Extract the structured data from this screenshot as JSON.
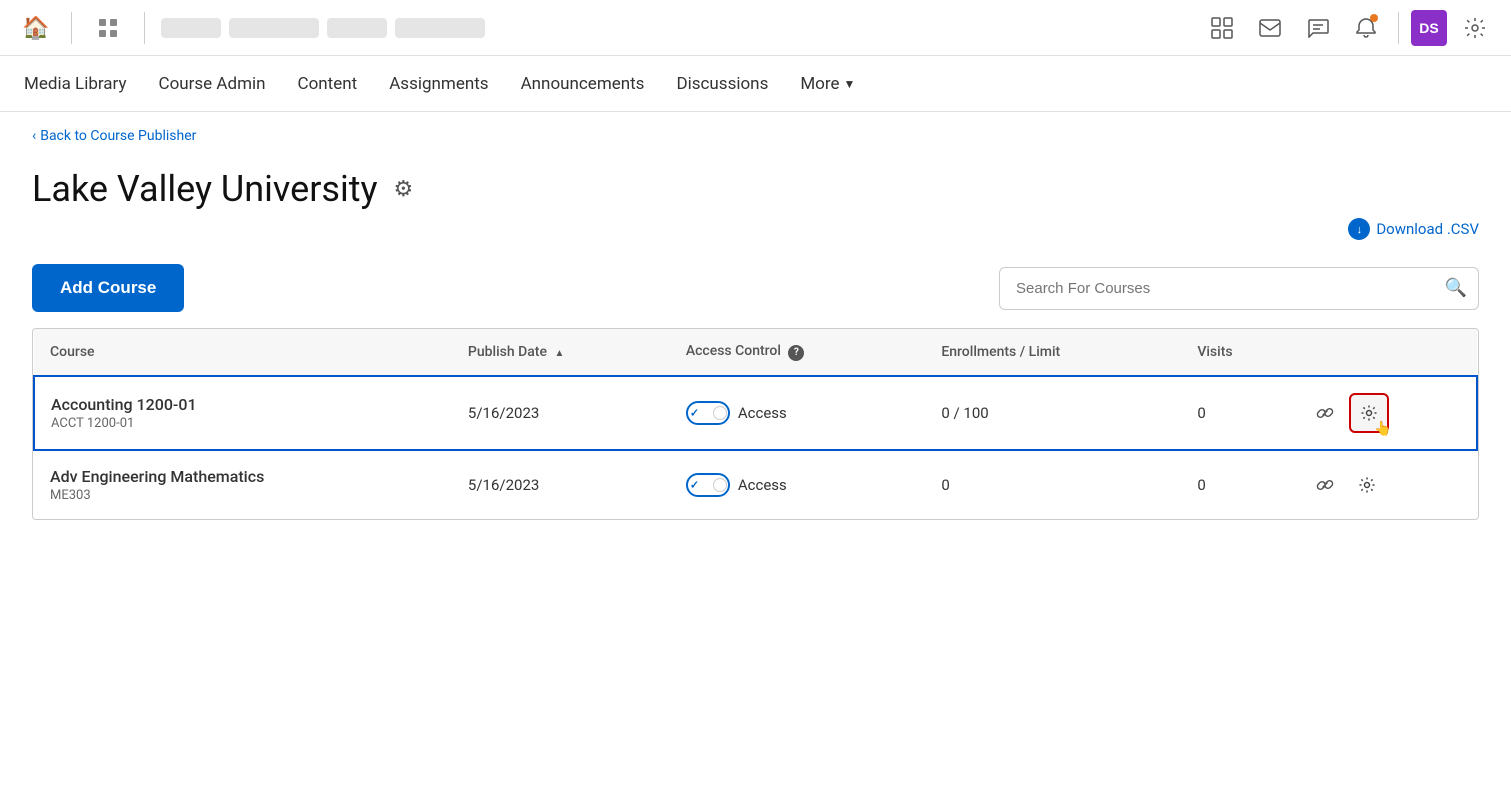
{
  "topbar": {
    "home_icon": "🏠",
    "grid_icon": "⊞",
    "mail_icon": "✉",
    "chat_icon": "💬",
    "bell_icon": "🔔",
    "avatar_text": "DS",
    "settings_icon": "⚙"
  },
  "secnav": {
    "items": [
      {
        "id": "media-library",
        "label": "Media Library"
      },
      {
        "id": "course-admin",
        "label": "Course Admin"
      },
      {
        "id": "content",
        "label": "Content"
      },
      {
        "id": "assignments",
        "label": "Assignments"
      },
      {
        "id": "announcements",
        "label": "Announcements"
      },
      {
        "id": "discussions",
        "label": "Discussions"
      },
      {
        "id": "more",
        "label": "More"
      }
    ]
  },
  "breadcrumb": {
    "label": "Back to Course Publisher"
  },
  "page": {
    "title": "Lake Valley University",
    "download_csv": "Download .CSV"
  },
  "toolbar": {
    "add_course_label": "Add Course",
    "search_placeholder": "Search For Courses"
  },
  "table": {
    "columns": [
      {
        "id": "course",
        "label": "Course"
      },
      {
        "id": "publish_date",
        "label": "Publish Date",
        "sortable": true
      },
      {
        "id": "access_control",
        "label": "Access Control",
        "has_help": true
      },
      {
        "id": "enrollments",
        "label": "Enrollments / Limit"
      },
      {
        "id": "visits",
        "label": "Visits"
      },
      {
        "id": "actions",
        "label": ""
      }
    ],
    "rows": [
      {
        "id": "row-1",
        "course_name": "Accounting 1200-01",
        "course_code": "ACCT 1200-01",
        "publish_date": "5/16/2023",
        "access_toggle": true,
        "access_label": "Access",
        "enrollments": "0 / 100",
        "visits": "0",
        "highlighted": true
      },
      {
        "id": "row-2",
        "course_name": "Adv Engineering Mathematics",
        "course_code": "ME303",
        "publish_date": "5/16/2023",
        "access_toggle": true,
        "access_label": "Access",
        "enrollments": "0",
        "visits": "0",
        "highlighted": false
      }
    ]
  }
}
